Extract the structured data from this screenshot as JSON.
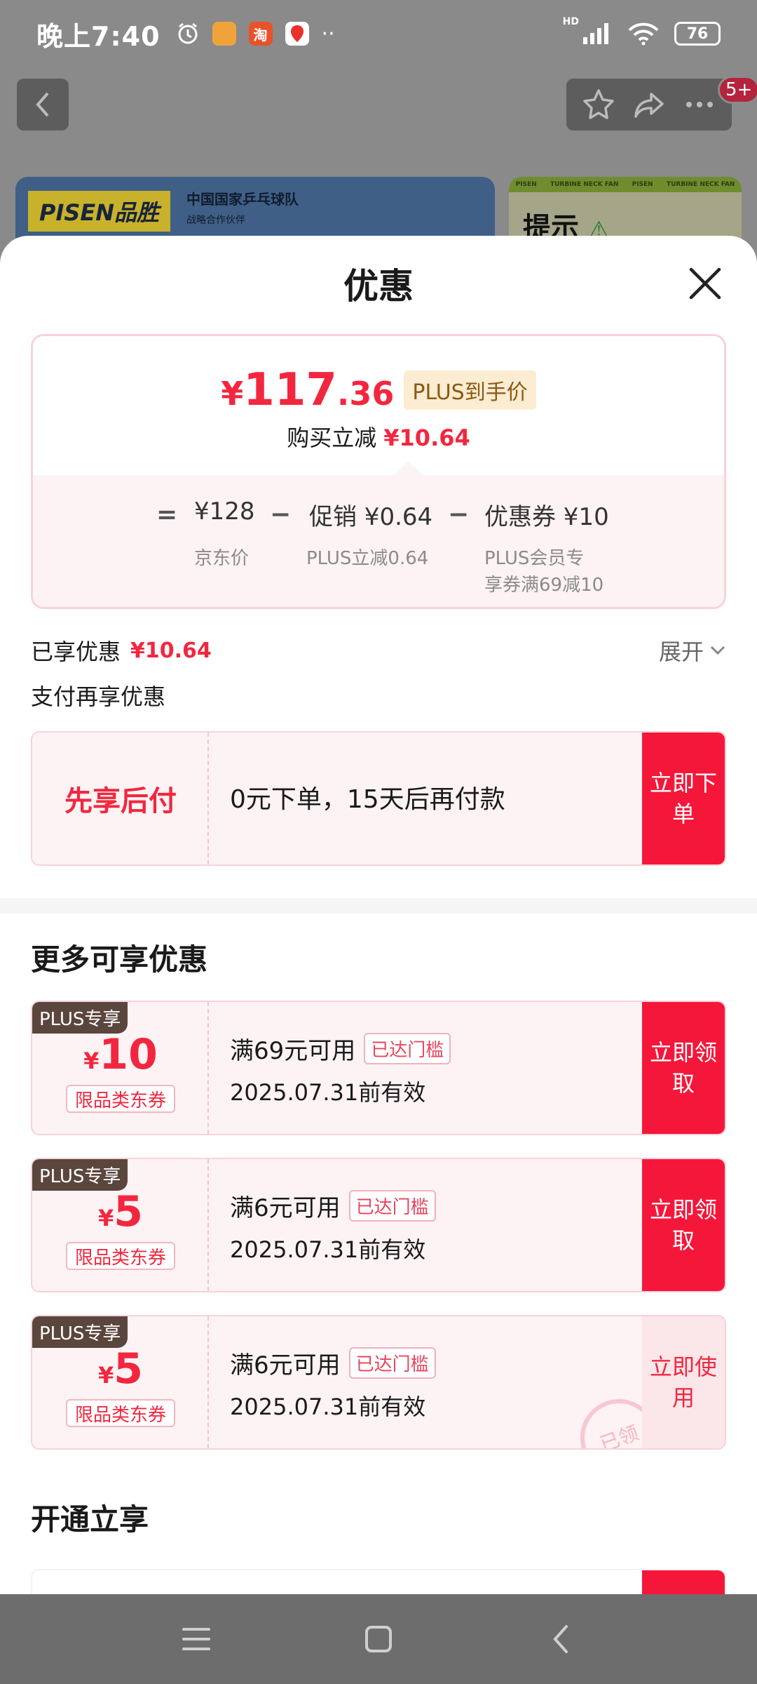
{
  "status_bar": {
    "time": "晚上7:40",
    "app_icons": [
      "alarm-icon",
      "notes-app-icon",
      "taobao-app-icon",
      "map-app-icon"
    ],
    "taobao_glyph": "淘",
    "battery": "76",
    "network_label": "HD"
  },
  "background_page": {
    "cart_badge": "5+",
    "banner_logo": "PISEN品胜",
    "banner_line1": "中国国家乒乓球队",
    "banner_line2": "战略合作伙伴",
    "banner2_strip": [
      "PISEN",
      "TURBINE NECK FAN",
      "PISEN",
      "TURBINE NECK FAN"
    ],
    "banner2_title": "提示"
  },
  "sheet": {
    "title": "优惠",
    "summary": {
      "yen": "¥",
      "price_int": "117",
      "price_dec": ".36",
      "price_tag": "PLUS到手价",
      "reduce_label": "购买立减",
      "reduce_amount": "¥10.64",
      "eq": "=",
      "minus": "−",
      "jd_price": "¥128",
      "jd_price_label": "京东价",
      "promo": "促销 ¥0.64",
      "promo_label": "PLUS立减0.64",
      "coupon": "优惠券 ¥10",
      "coupon_label_1": "PLUS会员专",
      "coupon_label_2": "享券满69减10"
    },
    "enjoyed_label": "已享优惠",
    "enjoyed_amount": "¥10.64",
    "expand_label": "展开",
    "pay_more_label": "支付再享优惠",
    "bnpl": {
      "title": "先享后付",
      "desc": "0元下单，15天后再付款",
      "button": "立即下单"
    },
    "more_title": "更多可享优惠",
    "coupons": [
      {
        "tag": "PLUS专享",
        "yen": "¥",
        "amount": "10",
        "type": "限品类东券",
        "condition": "满69元可用",
        "reached": "已达门槛",
        "valid": "2025.07.31前有效",
        "button": "立即领取",
        "stamp": ""
      },
      {
        "tag": "PLUS专享",
        "yen": "¥",
        "amount": "5",
        "type": "限品类东券",
        "condition": "满6元可用",
        "reached": "已达门槛",
        "valid": "2025.07.31前有效",
        "button": "立即领取",
        "stamp": ""
      },
      {
        "tag": "PLUS专享",
        "yen": "¥",
        "amount": "5",
        "type": "限品类东券",
        "condition": "满6元可用",
        "reached": "已达门槛",
        "valid": "2025.07.31前有效",
        "button": "立即使用",
        "stamp": "已领"
      }
    ],
    "open_title": "开通立享"
  },
  "colors": {
    "accent_red": "#f5173a",
    "price_red": "#f2273f",
    "plus_brown": "#5b463d",
    "card_pink": "#fdf3f4"
  }
}
